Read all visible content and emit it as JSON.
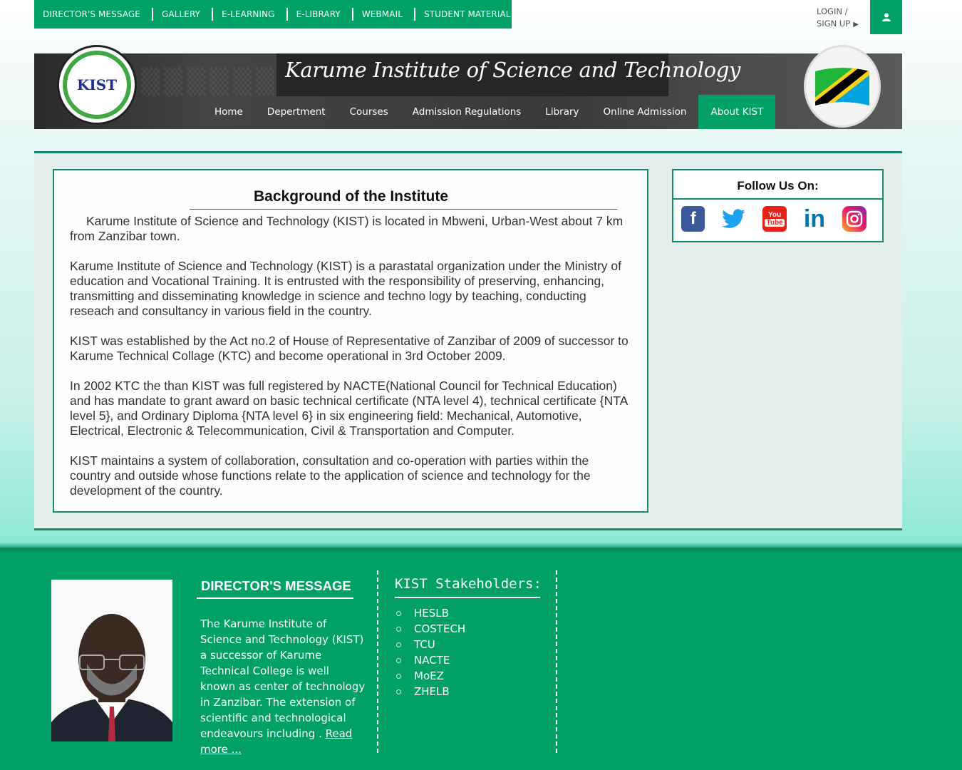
{
  "topbar": {
    "links": [
      "DIRECTOR'S MESSAGE",
      "GALLERY",
      "E-LEARNING",
      "E-LIBRARY",
      "WEBMAIL",
      "STUDENT MATERIAL"
    ],
    "login_line1": "LOGIN /",
    "login_line2": "SIGN UP",
    "user_icon": "user-icon"
  },
  "banner": {
    "title": "Karume Institute of Science and Technology",
    "logo_text": "KIST",
    "nav": [
      "Home",
      "Depertment",
      "Courses",
      "Admission Regulations",
      "Library",
      "Online Admission",
      "About KIST"
    ],
    "active_nav": "About KIST"
  },
  "article": {
    "heading": "Background of the Institute",
    "paragraphs": [
      "Karume Institute of Science and Technology (KIST) is located in Mbweni, Urban-West about 7 km from Zanzibar town.",
      "Karume Institute of Science and Technology (KIST) is a parastatal organization under the Ministry of education and Vocational Training. It is entrusted with the responsibility of preserving, enhancing, transmitting and disseminating knowledge in science and techno logy by teaching, conducting reseach and consultancy in various field in the country.",
      "KIST was established by the Act no.2 of House of Representative of Zanzibar of 2009 of successor to Karume Technical Collage (KTC) and become operational in 3rd October 2009.",
      "In 2002 KTC the than KIST was full registered by NACTE(National Council for Technical Education) and has mandate to grant award on basic technical certificate (NTA level 4), technical certificate {NTA level 5}, and Ordinary Diploma {NTA level 6} in six engineering field: Mechanical, Automotive, Electrical, Electronic & Telecommunication, Civil & Transportation and Computer.",
      "KIST maintains a system of collaboration, consultation and co-operation with parties within the country and outside whose functions relate to the application of science and technology for the development of the country."
    ]
  },
  "follow": {
    "title": "Follow Us On:",
    "icons": [
      "facebook-icon",
      "twitter-icon",
      "youtube-icon",
      "linkedin-icon",
      "instagram-icon"
    ],
    "colors": {
      "facebook": "#3b5998",
      "twitter": "#1da1f2",
      "youtube": "#e62117",
      "linkedin": "#0077b5",
      "instagram": "#c13584"
    }
  },
  "footer": {
    "director_title": "DIRECTOR'S MESSAGE",
    "director_text": "The Karume Institute of Science and Technology (KIST) a successor of Karume Technical College is well known as center of technology in Zanzibar. The extension of scientific and technological endeavours including . ",
    "read_more": "Read more ...",
    "stakeholders_title": "KIST Stakeholders:",
    "stakeholders": [
      "HESLB",
      "COSTECH",
      "TCU",
      "NACTE",
      "MoEZ",
      "ZHELB"
    ]
  },
  "colors": {
    "brand_green": "#01a066",
    "dark_green": "#178a6b"
  }
}
